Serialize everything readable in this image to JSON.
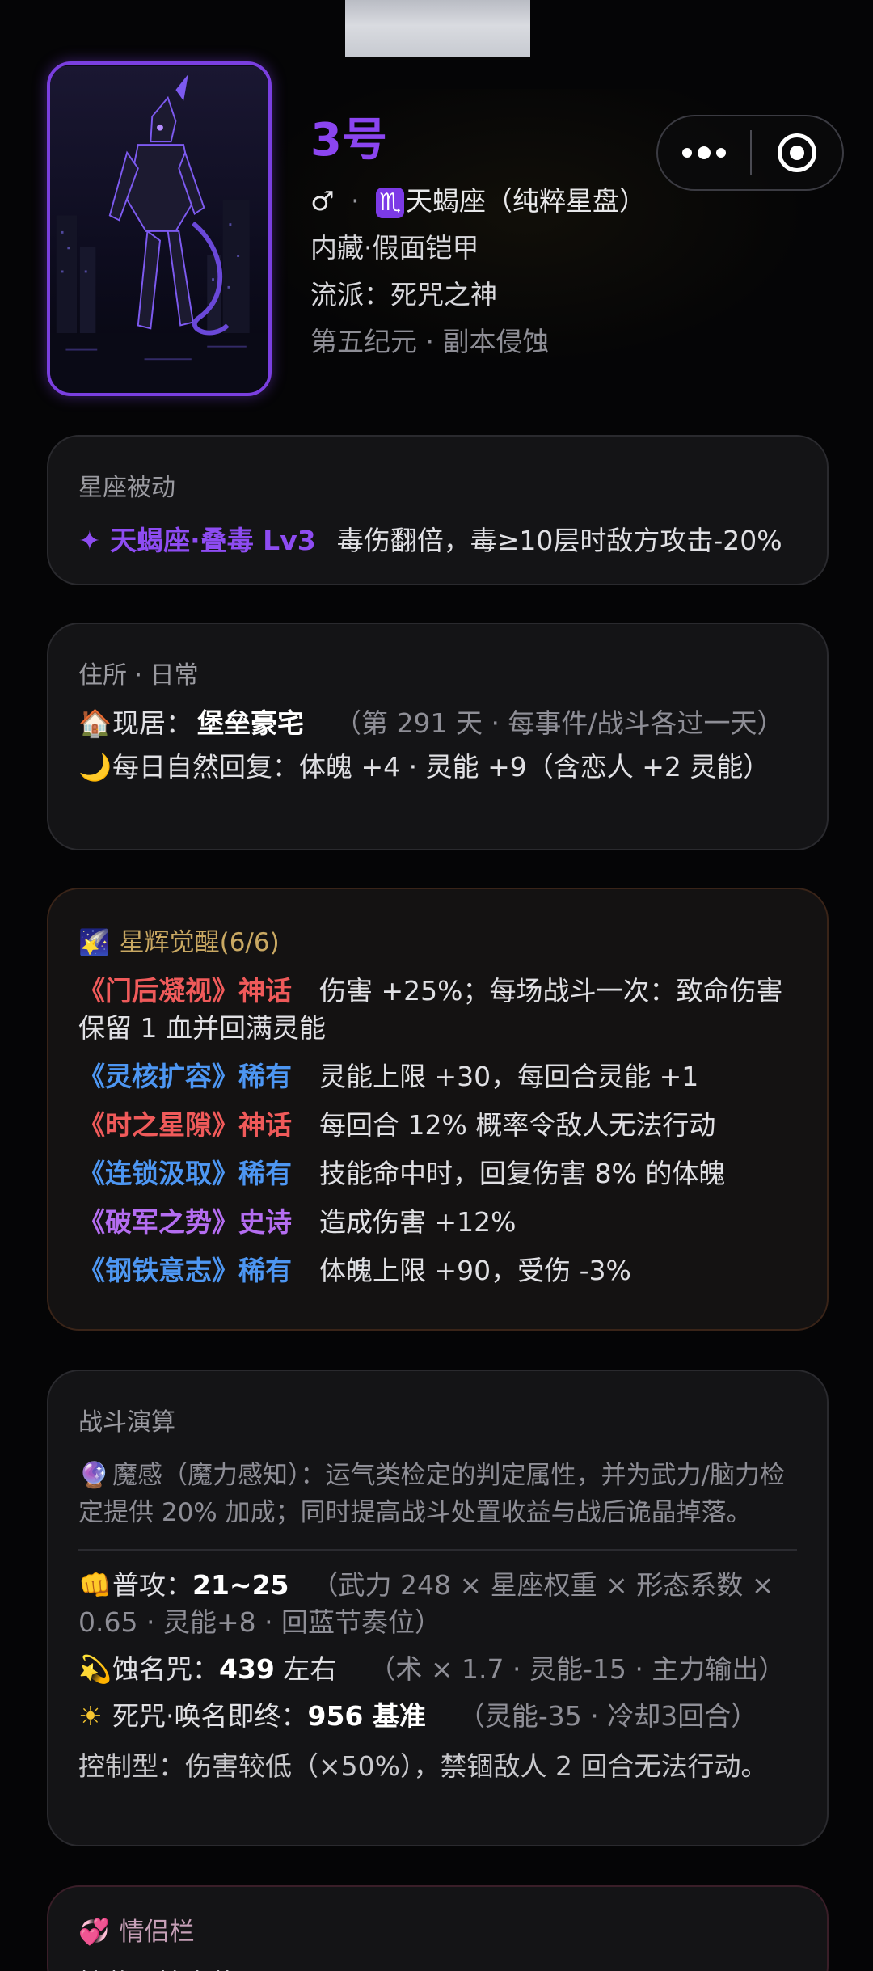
{
  "hero": {
    "name": "3号",
    "gender_symbol": "♂",
    "separator": "·",
    "zodiac_symbol": "♏",
    "sign_text": "天蝎座（纯粹星盘）",
    "hidden": "内藏·假面铠甲",
    "school": "流派：死咒之神",
    "era": "第五纪元 · 副本侵蚀"
  },
  "capsule": {
    "more_icon": "more-dots-icon",
    "close_icon": "target-circle-icon"
  },
  "passive": {
    "title": "星座被动",
    "icon": "✦",
    "name": "天蝎座·叠毒 Lv3",
    "desc": "毒伤翻倍，毒≥10层时敌方攻击-20%"
  },
  "home": {
    "title": "住所 · 日常",
    "residence_icon": "🏠",
    "residence_label": "现居：",
    "residence_name": "堡垒豪宅",
    "residence_note": "（第 291 天 · 每事件/战斗各过一天）",
    "recover_icon": "🌙",
    "recover_text": "每日自然回复：体魄 +4 · 灵能 +9（含恋人 +2 灵能）"
  },
  "awaken": {
    "icon": "🌠",
    "title": "星辉觉醒(6/6)",
    "items": [
      {
        "name": "《门后凝视》神话",
        "desc": "伤害 +25%；每场战斗一次：致命伤害保留 1 血并回满灵能",
        "tier": "myth"
      },
      {
        "name": "《灵核扩容》稀有",
        "desc": "灵能上限 +30，每回合灵能 +1",
        "tier": "rare"
      },
      {
        "name": "《时之星隙》神话",
        "desc": "每回合 12% 概率令敌人无法行动",
        "tier": "myth"
      },
      {
        "name": "《连锁汲取》稀有",
        "desc": "技能命中时，回复伤害 8% 的体魄",
        "tier": "rare"
      },
      {
        "name": "《破军之势》史诗",
        "desc": "造成伤害 +12%",
        "tier": "epic"
      },
      {
        "name": "《钢铁意志》稀有",
        "desc": "体魄上限 +90，受伤 -3%",
        "tier": "rare"
      }
    ]
  },
  "battle": {
    "title": "战斗演算",
    "magic_icon": "🔮",
    "magic_text": "魔感（魔力感知）：运气类检定的判定属性，并为武力/脑力检定提供 20% 加成；同时提高战斗处置收益与战后诡晶掉落。",
    "attack_icon": "👊",
    "attack_label": "普攻：",
    "attack_value": "21~25",
    "attack_note": "（武力 248 × 星座权重 × 形态系数 × 0.65 · 灵能+8 · 回蓝节奏位）",
    "curse_icon": "💫",
    "curse_label": "蚀名咒：",
    "curse_value": "439",
    "curse_suffix": " 左右",
    "curse_note": "（术 × 1.7 · 灵能-15 · 主力输出）",
    "ult_icon": "☀",
    "ult_label": "死咒·唤名即终：",
    "ult_value": "956 基准",
    "ult_note": "（灵能-35 · 冷却3回合）",
    "control_text": "控制型：伤害较低（×50%），禁锢敌人 2 回合无法行动。"
  },
  "couple": {
    "icon": "💞",
    "title": "情侣栏",
    "sub": "挂载 · 挂出状"
  },
  "colors": {
    "accent_purple": "#8b45f0",
    "myth_red": "#ef5a5a",
    "rare_blue": "#4d96f2",
    "epic_violet": "#b46df0",
    "gold_title": "#c9a862"
  }
}
